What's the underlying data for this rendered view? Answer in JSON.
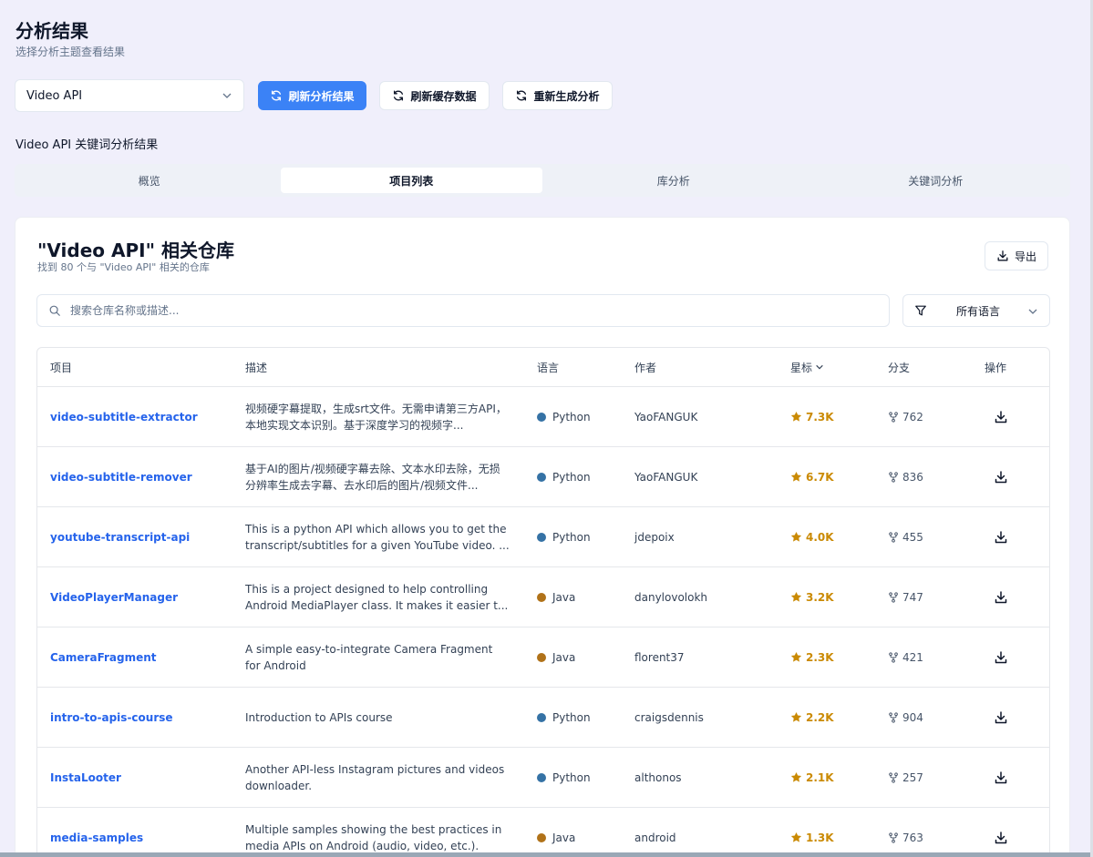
{
  "header": {
    "title": "分析结果",
    "subtitle": "选择分析主题查看结果"
  },
  "controls": {
    "topic_value": "Video API",
    "refresh_analysis": "刷新分析结果",
    "refresh_cache": "刷新缓存数据",
    "regenerate": "重新生成分析"
  },
  "section_heading": "Video API 关键词分析结果",
  "tabs": [
    {
      "label": "概览",
      "active": false
    },
    {
      "label": "项目列表",
      "active": true
    },
    {
      "label": "库分析",
      "active": false
    },
    {
      "label": "关键词分析",
      "active": false
    }
  ],
  "card": {
    "title": "\"Video API\" 相关仓库",
    "subtitle": "找到 80 个与 \"Video API\" 相关的仓库",
    "export_label": "导出",
    "search_placeholder": "搜索仓库名称或描述...",
    "language_filter": "所有语言"
  },
  "table": {
    "headers": {
      "project": "项目",
      "description": "描述",
      "language": "语言",
      "author": "作者",
      "stars": "星标",
      "forks": "分支",
      "actions": "操作"
    },
    "language_colors": {
      "Python": "#3572A5",
      "Java": "#b07219"
    },
    "rows": [
      {
        "name": "video-subtitle-extractor",
        "description": "视频硬字幕提取，生成srt文件。无需申请第三方API，本地实现文本识别。基于深度学习的视频字...",
        "language": "Python",
        "author": "YaoFANGUK",
        "stars": "7.3K",
        "forks": "762"
      },
      {
        "name": "video-subtitle-remover",
        "description": "基于AI的图片/视频硬字幕去除、文本水印去除，无损分辨率生成去字幕、去水印后的图片/视频文件...",
        "language": "Python",
        "author": "YaoFANGUK",
        "stars": "6.7K",
        "forks": "836"
      },
      {
        "name": "youtube-transcript-api",
        "description": "This is a python API which allows you to get the transcript/subtitles for a given YouTube video. ...",
        "language": "Python",
        "author": "jdepoix",
        "stars": "4.0K",
        "forks": "455"
      },
      {
        "name": "VideoPlayerManager",
        "description": "This is a project designed to help controlling Android MediaPlayer class. It makes it easier t...",
        "language": "Java",
        "author": "danylovolokh",
        "stars": "3.2K",
        "forks": "747"
      },
      {
        "name": "CameraFragment",
        "description": "A simple easy-to-integrate Camera Fragment for Android",
        "language": "Java",
        "author": "florent37",
        "stars": "2.3K",
        "forks": "421"
      },
      {
        "name": "intro-to-apis-course",
        "description": "Introduction to APIs course",
        "language": "Python",
        "author": "craigsdennis",
        "stars": "2.2K",
        "forks": "904"
      },
      {
        "name": "InstaLooter",
        "description": "Another API-less Instagram pictures and videos downloader.",
        "language": "Python",
        "author": "althonos",
        "stars": "2.1K",
        "forks": "257"
      },
      {
        "name": "media-samples",
        "description": "Multiple samples showing the best practices in media APIs on Android (audio, video, etc.).",
        "language": "Java",
        "author": "android",
        "stars": "1.3K",
        "forks": "763"
      }
    ]
  }
}
